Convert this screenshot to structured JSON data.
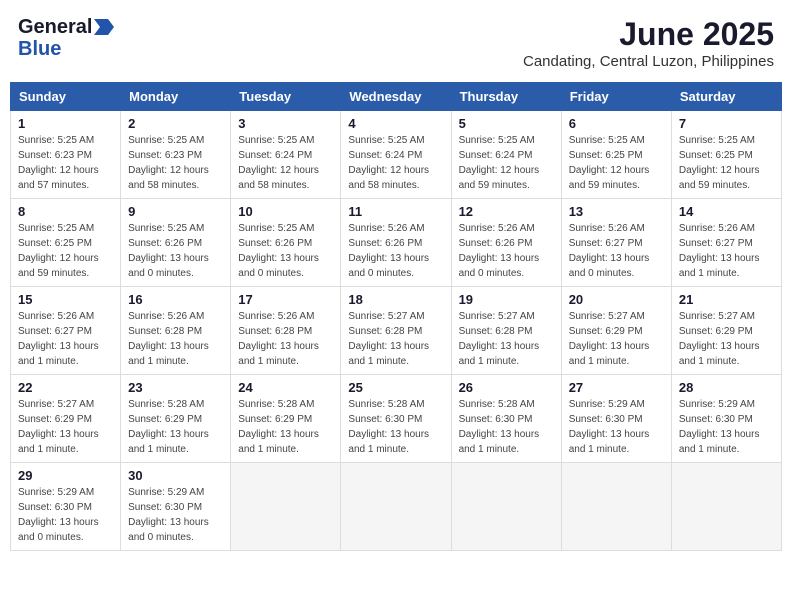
{
  "header": {
    "logo_general": "General",
    "logo_blue": "Blue",
    "month_year": "June 2025",
    "location": "Candating, Central Luzon, Philippines"
  },
  "weekdays": [
    "Sunday",
    "Monday",
    "Tuesday",
    "Wednesday",
    "Thursday",
    "Friday",
    "Saturday"
  ],
  "weeks": [
    [
      {
        "day": "1",
        "sunrise": "Sunrise: 5:25 AM",
        "sunset": "Sunset: 6:23 PM",
        "daylight": "Daylight: 12 hours and 57 minutes."
      },
      {
        "day": "2",
        "sunrise": "Sunrise: 5:25 AM",
        "sunset": "Sunset: 6:23 PM",
        "daylight": "Daylight: 12 hours and 58 minutes."
      },
      {
        "day": "3",
        "sunrise": "Sunrise: 5:25 AM",
        "sunset": "Sunset: 6:24 PM",
        "daylight": "Daylight: 12 hours and 58 minutes."
      },
      {
        "day": "4",
        "sunrise": "Sunrise: 5:25 AM",
        "sunset": "Sunset: 6:24 PM",
        "daylight": "Daylight: 12 hours and 58 minutes."
      },
      {
        "day": "5",
        "sunrise": "Sunrise: 5:25 AM",
        "sunset": "Sunset: 6:24 PM",
        "daylight": "Daylight: 12 hours and 59 minutes."
      },
      {
        "day": "6",
        "sunrise": "Sunrise: 5:25 AM",
        "sunset": "Sunset: 6:25 PM",
        "daylight": "Daylight: 12 hours and 59 minutes."
      },
      {
        "day": "7",
        "sunrise": "Sunrise: 5:25 AM",
        "sunset": "Sunset: 6:25 PM",
        "daylight": "Daylight: 12 hours and 59 minutes."
      }
    ],
    [
      {
        "day": "8",
        "sunrise": "Sunrise: 5:25 AM",
        "sunset": "Sunset: 6:25 PM",
        "daylight": "Daylight: 12 hours and 59 minutes."
      },
      {
        "day": "9",
        "sunrise": "Sunrise: 5:25 AM",
        "sunset": "Sunset: 6:26 PM",
        "daylight": "Daylight: 13 hours and 0 minutes."
      },
      {
        "day": "10",
        "sunrise": "Sunrise: 5:25 AM",
        "sunset": "Sunset: 6:26 PM",
        "daylight": "Daylight: 13 hours and 0 minutes."
      },
      {
        "day": "11",
        "sunrise": "Sunrise: 5:26 AM",
        "sunset": "Sunset: 6:26 PM",
        "daylight": "Daylight: 13 hours and 0 minutes."
      },
      {
        "day": "12",
        "sunrise": "Sunrise: 5:26 AM",
        "sunset": "Sunset: 6:26 PM",
        "daylight": "Daylight: 13 hours and 0 minutes."
      },
      {
        "day": "13",
        "sunrise": "Sunrise: 5:26 AM",
        "sunset": "Sunset: 6:27 PM",
        "daylight": "Daylight: 13 hours and 0 minutes."
      },
      {
        "day": "14",
        "sunrise": "Sunrise: 5:26 AM",
        "sunset": "Sunset: 6:27 PM",
        "daylight": "Daylight: 13 hours and 1 minute."
      }
    ],
    [
      {
        "day": "15",
        "sunrise": "Sunrise: 5:26 AM",
        "sunset": "Sunset: 6:27 PM",
        "daylight": "Daylight: 13 hours and 1 minute."
      },
      {
        "day": "16",
        "sunrise": "Sunrise: 5:26 AM",
        "sunset": "Sunset: 6:28 PM",
        "daylight": "Daylight: 13 hours and 1 minute."
      },
      {
        "day": "17",
        "sunrise": "Sunrise: 5:26 AM",
        "sunset": "Sunset: 6:28 PM",
        "daylight": "Daylight: 13 hours and 1 minute."
      },
      {
        "day": "18",
        "sunrise": "Sunrise: 5:27 AM",
        "sunset": "Sunset: 6:28 PM",
        "daylight": "Daylight: 13 hours and 1 minute."
      },
      {
        "day": "19",
        "sunrise": "Sunrise: 5:27 AM",
        "sunset": "Sunset: 6:28 PM",
        "daylight": "Daylight: 13 hours and 1 minute."
      },
      {
        "day": "20",
        "sunrise": "Sunrise: 5:27 AM",
        "sunset": "Sunset: 6:29 PM",
        "daylight": "Daylight: 13 hours and 1 minute."
      },
      {
        "day": "21",
        "sunrise": "Sunrise: 5:27 AM",
        "sunset": "Sunset: 6:29 PM",
        "daylight": "Daylight: 13 hours and 1 minute."
      }
    ],
    [
      {
        "day": "22",
        "sunrise": "Sunrise: 5:27 AM",
        "sunset": "Sunset: 6:29 PM",
        "daylight": "Daylight: 13 hours and 1 minute."
      },
      {
        "day": "23",
        "sunrise": "Sunrise: 5:28 AM",
        "sunset": "Sunset: 6:29 PM",
        "daylight": "Daylight: 13 hours and 1 minute."
      },
      {
        "day": "24",
        "sunrise": "Sunrise: 5:28 AM",
        "sunset": "Sunset: 6:29 PM",
        "daylight": "Daylight: 13 hours and 1 minute."
      },
      {
        "day": "25",
        "sunrise": "Sunrise: 5:28 AM",
        "sunset": "Sunset: 6:30 PM",
        "daylight": "Daylight: 13 hours and 1 minute."
      },
      {
        "day": "26",
        "sunrise": "Sunrise: 5:28 AM",
        "sunset": "Sunset: 6:30 PM",
        "daylight": "Daylight: 13 hours and 1 minute."
      },
      {
        "day": "27",
        "sunrise": "Sunrise: 5:29 AM",
        "sunset": "Sunset: 6:30 PM",
        "daylight": "Daylight: 13 hours and 1 minute."
      },
      {
        "day": "28",
        "sunrise": "Sunrise: 5:29 AM",
        "sunset": "Sunset: 6:30 PM",
        "daylight": "Daylight: 13 hours and 1 minute."
      }
    ],
    [
      {
        "day": "29",
        "sunrise": "Sunrise: 5:29 AM",
        "sunset": "Sunset: 6:30 PM",
        "daylight": "Daylight: 13 hours and 0 minutes."
      },
      {
        "day": "30",
        "sunrise": "Sunrise: 5:29 AM",
        "sunset": "Sunset: 6:30 PM",
        "daylight": "Daylight: 13 hours and 0 minutes."
      },
      null,
      null,
      null,
      null,
      null
    ]
  ]
}
